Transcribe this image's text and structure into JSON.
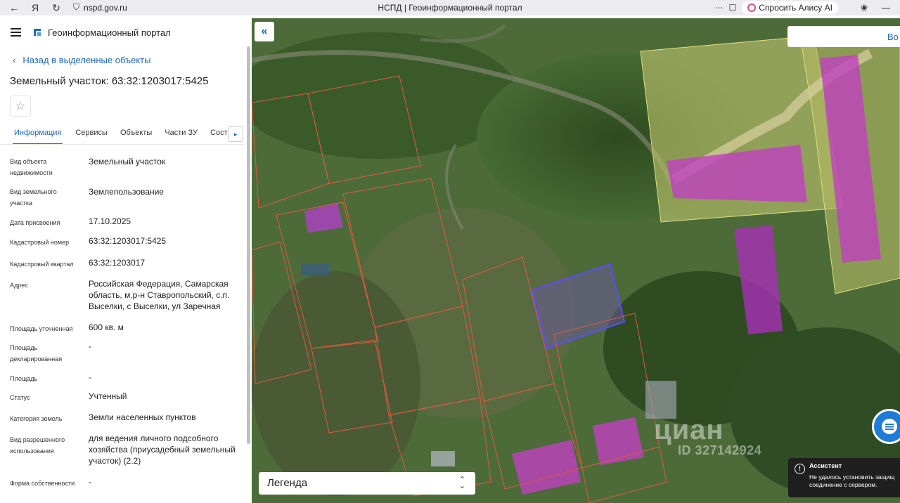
{
  "browser": {
    "url": "nspd.gov.ru",
    "title": "НСПД | Геоинформационный портал",
    "alisa_label": "Спросить Алису AI"
  },
  "sidebar": {
    "portal_title": "Геоинформационный портал",
    "back_link": "Назад в выделенные объекты",
    "object_title": "Земельный участок: 63:32:1203017:5425",
    "tabs": [
      "Информация",
      "Сервисы",
      "Объекты",
      "Части ЗУ",
      "Состав"
    ],
    "properties": [
      {
        "label": "Вид объекта недвижимости",
        "value": "Земельный участок"
      },
      {
        "label": "Вид земельного участка",
        "value": "Землепользование"
      },
      {
        "label": "Дата присвоения",
        "value": "17.10.2025"
      },
      {
        "label": "Кадастровый номер",
        "value": "63:32:1203017:5425"
      },
      {
        "label": "Кадастровый квартал",
        "value": "63:32:1203017"
      },
      {
        "label": "Адрес",
        "value": "Российская Федерация, Самарская область, м.р-н Ставропольский, с.п. Выселки, с Выселки, ул Заречная"
      },
      {
        "label": "Площадь уточненная",
        "value": "600 кв. м"
      },
      {
        "label": "Площадь декларированная",
        "value": "-"
      },
      {
        "label": "Площадь",
        "value": "-"
      },
      {
        "label": "Статус",
        "value": "Учтенный"
      },
      {
        "label": "Категория земель",
        "value": "Земли населенных пунктов"
      },
      {
        "label": "Вид разрешенного использования",
        "value": "для ведения личного подсобного хозяйства (приусадебный земельный участок) (2.2)"
      },
      {
        "label": "Форма собственности",
        "value": "-"
      }
    ]
  },
  "map": {
    "search_text": "Во",
    "legend_label": "Легенда",
    "watermark": "циан",
    "watermark_id": "ID 327142924",
    "assistant": {
      "title": "Ассистент",
      "message_line1": "Не удалось установить защищ",
      "message_line2": "соединение с сервером."
    }
  }
}
